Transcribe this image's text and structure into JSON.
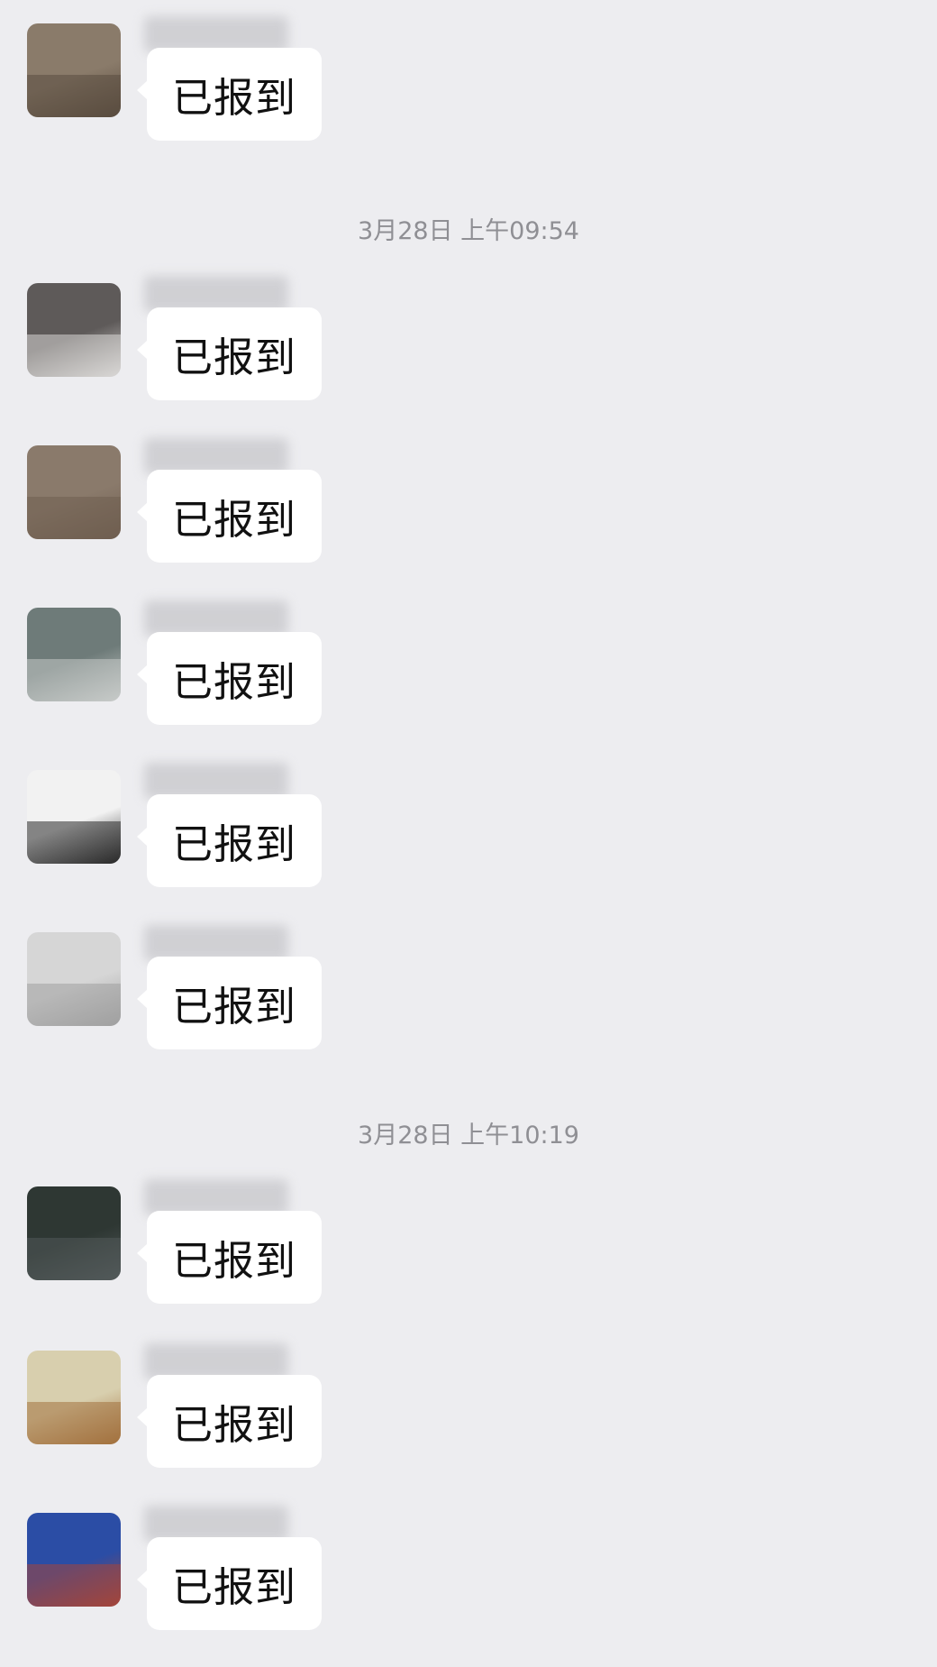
{
  "timestamps": [
    "3月28日 上午09:54",
    "3月28日 上午10:19"
  ],
  "messages": [
    {
      "text": "已报到",
      "avatar_colors": [
        "#8a7b6a",
        "#5a4c3f"
      ]
    },
    {
      "text": "已报到",
      "avatar_colors": [
        "#5e5a59",
        "#d9d7d5"
      ]
    },
    {
      "text": "已报到",
      "avatar_colors": [
        "#8a7a6b",
        "#6f5e50"
      ]
    },
    {
      "text": "已报到",
      "avatar_colors": [
        "#6e7b79",
        "#c7cac8"
      ]
    },
    {
      "text": "已报到",
      "avatar_colors": [
        "#f2f2f2",
        "#2a2a2a"
      ]
    },
    {
      "text": "已报到",
      "avatar_colors": [
        "#d6d6d6",
        "#a0a0a0"
      ]
    },
    {
      "text": "已报到",
      "avatar_colors": [
        "#2e3733",
        "#52595a"
      ]
    },
    {
      "text": "已报到",
      "avatar_colors": [
        "#d8cfae",
        "#a3713e"
      ]
    },
    {
      "text": "已报到",
      "avatar_colors": [
        "#2b4da5",
        "#a4453a"
      ]
    }
  ]
}
